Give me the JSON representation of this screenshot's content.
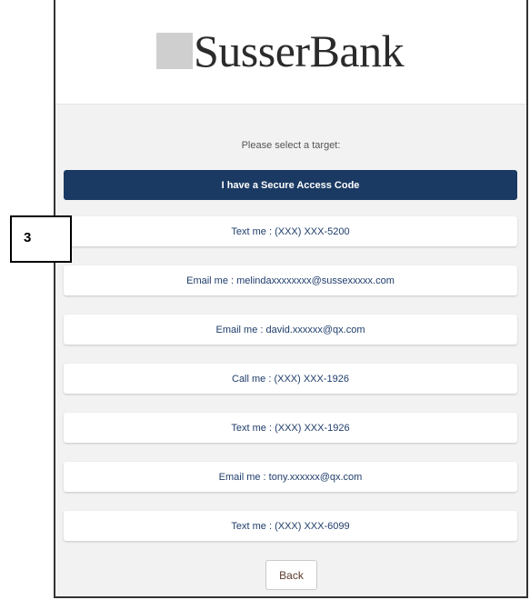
{
  "brand": {
    "name": "SusserBank"
  },
  "prompt": "Please select a target:",
  "options": [
    {
      "label": "I have a Secure Access Code",
      "primary": true
    },
    {
      "label": "Text me : (XXX) XXX-5200"
    },
    {
      "label": "Email me : melindaxxxxxxxx@sussexxxxx.com"
    },
    {
      "label": "Email me : david.xxxxxx@qx.com"
    },
    {
      "label": "Call me : (XXX) XXX-1926"
    },
    {
      "label": "Text me : (XXX) XXX-1926"
    },
    {
      "label": "Email me : tony.xxxxxx@qx.com"
    },
    {
      "label": "Text me : (XXX) XXX-6099"
    }
  ],
  "back_label": "Back",
  "annotation": {
    "label": "3"
  },
  "colors": {
    "primary": "#1b3a63",
    "option_text": "#1f3d6b",
    "background": "#f2f2f2"
  }
}
